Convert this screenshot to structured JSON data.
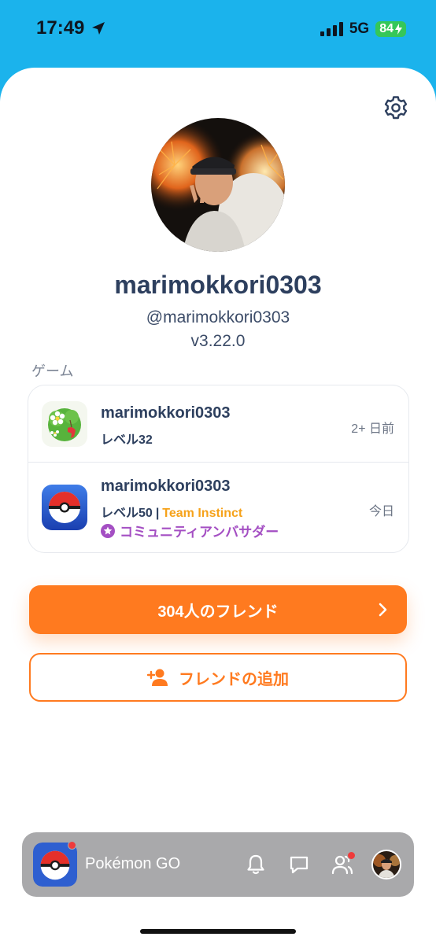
{
  "status": {
    "time": "17:49",
    "network": "5G",
    "battery": "84"
  },
  "profile": {
    "display_name": "marimokkori0303",
    "handle": "@marimokkori0303",
    "version": "v3.22.0"
  },
  "games_section": {
    "label": "ゲーム",
    "games": [
      {
        "icon": "pikmin-bloom-icon",
        "name": "marimokkori0303",
        "level": "レベル32",
        "time": "2+ 日前"
      },
      {
        "icon": "pokemon-go-icon",
        "name": "marimokkori0303",
        "level": "レベル50",
        "separator": "|",
        "team": "Team Instinct",
        "badge": "コミュニティアンバサダー",
        "time": "今日"
      }
    ]
  },
  "buttons": {
    "friends_label": "304人のフレンド",
    "add_friend_label": "フレンドの追加"
  },
  "bottom_bar": {
    "app_name": "Pokémon GO"
  },
  "colors": {
    "accent": "#ff7a1f",
    "header": "#1bb3ec",
    "text": "#2d3f5e",
    "team": "#f6a21a",
    "ambassador": "#a44fc3"
  }
}
